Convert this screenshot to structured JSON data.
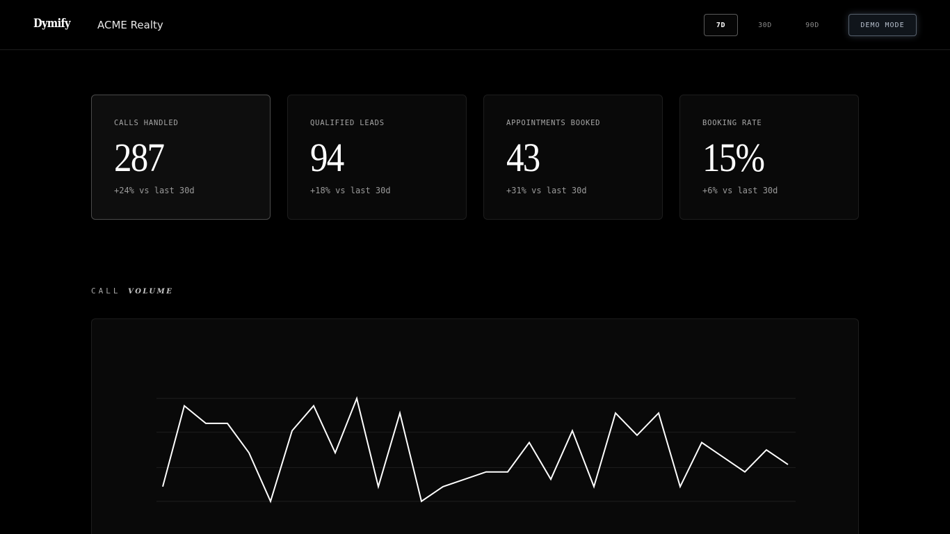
{
  "header": {
    "brand": "Dymify",
    "organization": "ACME Realty",
    "ranges": [
      "7D",
      "30D",
      "90D"
    ],
    "active_range": "7D",
    "demo_label": "DEMO MODE"
  },
  "kpis": [
    {
      "label": "CALLS HANDLED",
      "value": "287",
      "delta": "+24% vs last 30d"
    },
    {
      "label": "QUALIFIED LEADS",
      "value": "94",
      "delta": "+18% vs last 30d"
    },
    {
      "label": "APPOINTMENTS BOOKED",
      "value": "43",
      "delta": "+31% vs last 30d"
    },
    {
      "label": "BOOKING RATE",
      "value": "15%",
      "delta": "+6% vs last 30d"
    }
  ],
  "section": {
    "title_plain": "CALL",
    "title_emph": "VOLUME"
  },
  "colors": {
    "background": "#000000",
    "card": "#090909",
    "line": "#ffffff",
    "demo_accent": "#56606c"
  },
  "chart_data": {
    "type": "line",
    "x": [
      1,
      2,
      3,
      4,
      5,
      6,
      7,
      8,
      9,
      10,
      11,
      12,
      13,
      14,
      15,
      16,
      17,
      18,
      19,
      20,
      21,
      22,
      23,
      24,
      25,
      26,
      27,
      28,
      29,
      30
    ],
    "series": [
      {
        "values": [
          3.0,
          8.5,
          7.3,
          7.3,
          5.3,
          2.0,
          6.8,
          8.5,
          5.3,
          9.0,
          3.0,
          8.0,
          2.0,
          3.0,
          3.5,
          4.0,
          4.0,
          6.0,
          3.5,
          6.8,
          3.0,
          8.0,
          6.5,
          8.0,
          3.0,
          6.0,
          5.0,
          4.0,
          5.5,
          4.5
        ]
      }
    ],
    "ylim": [
      0,
      9
    ],
    "grid": true,
    "gridlines": [
      2.0,
      4.3,
      6.7,
      9.0
    ]
  }
}
